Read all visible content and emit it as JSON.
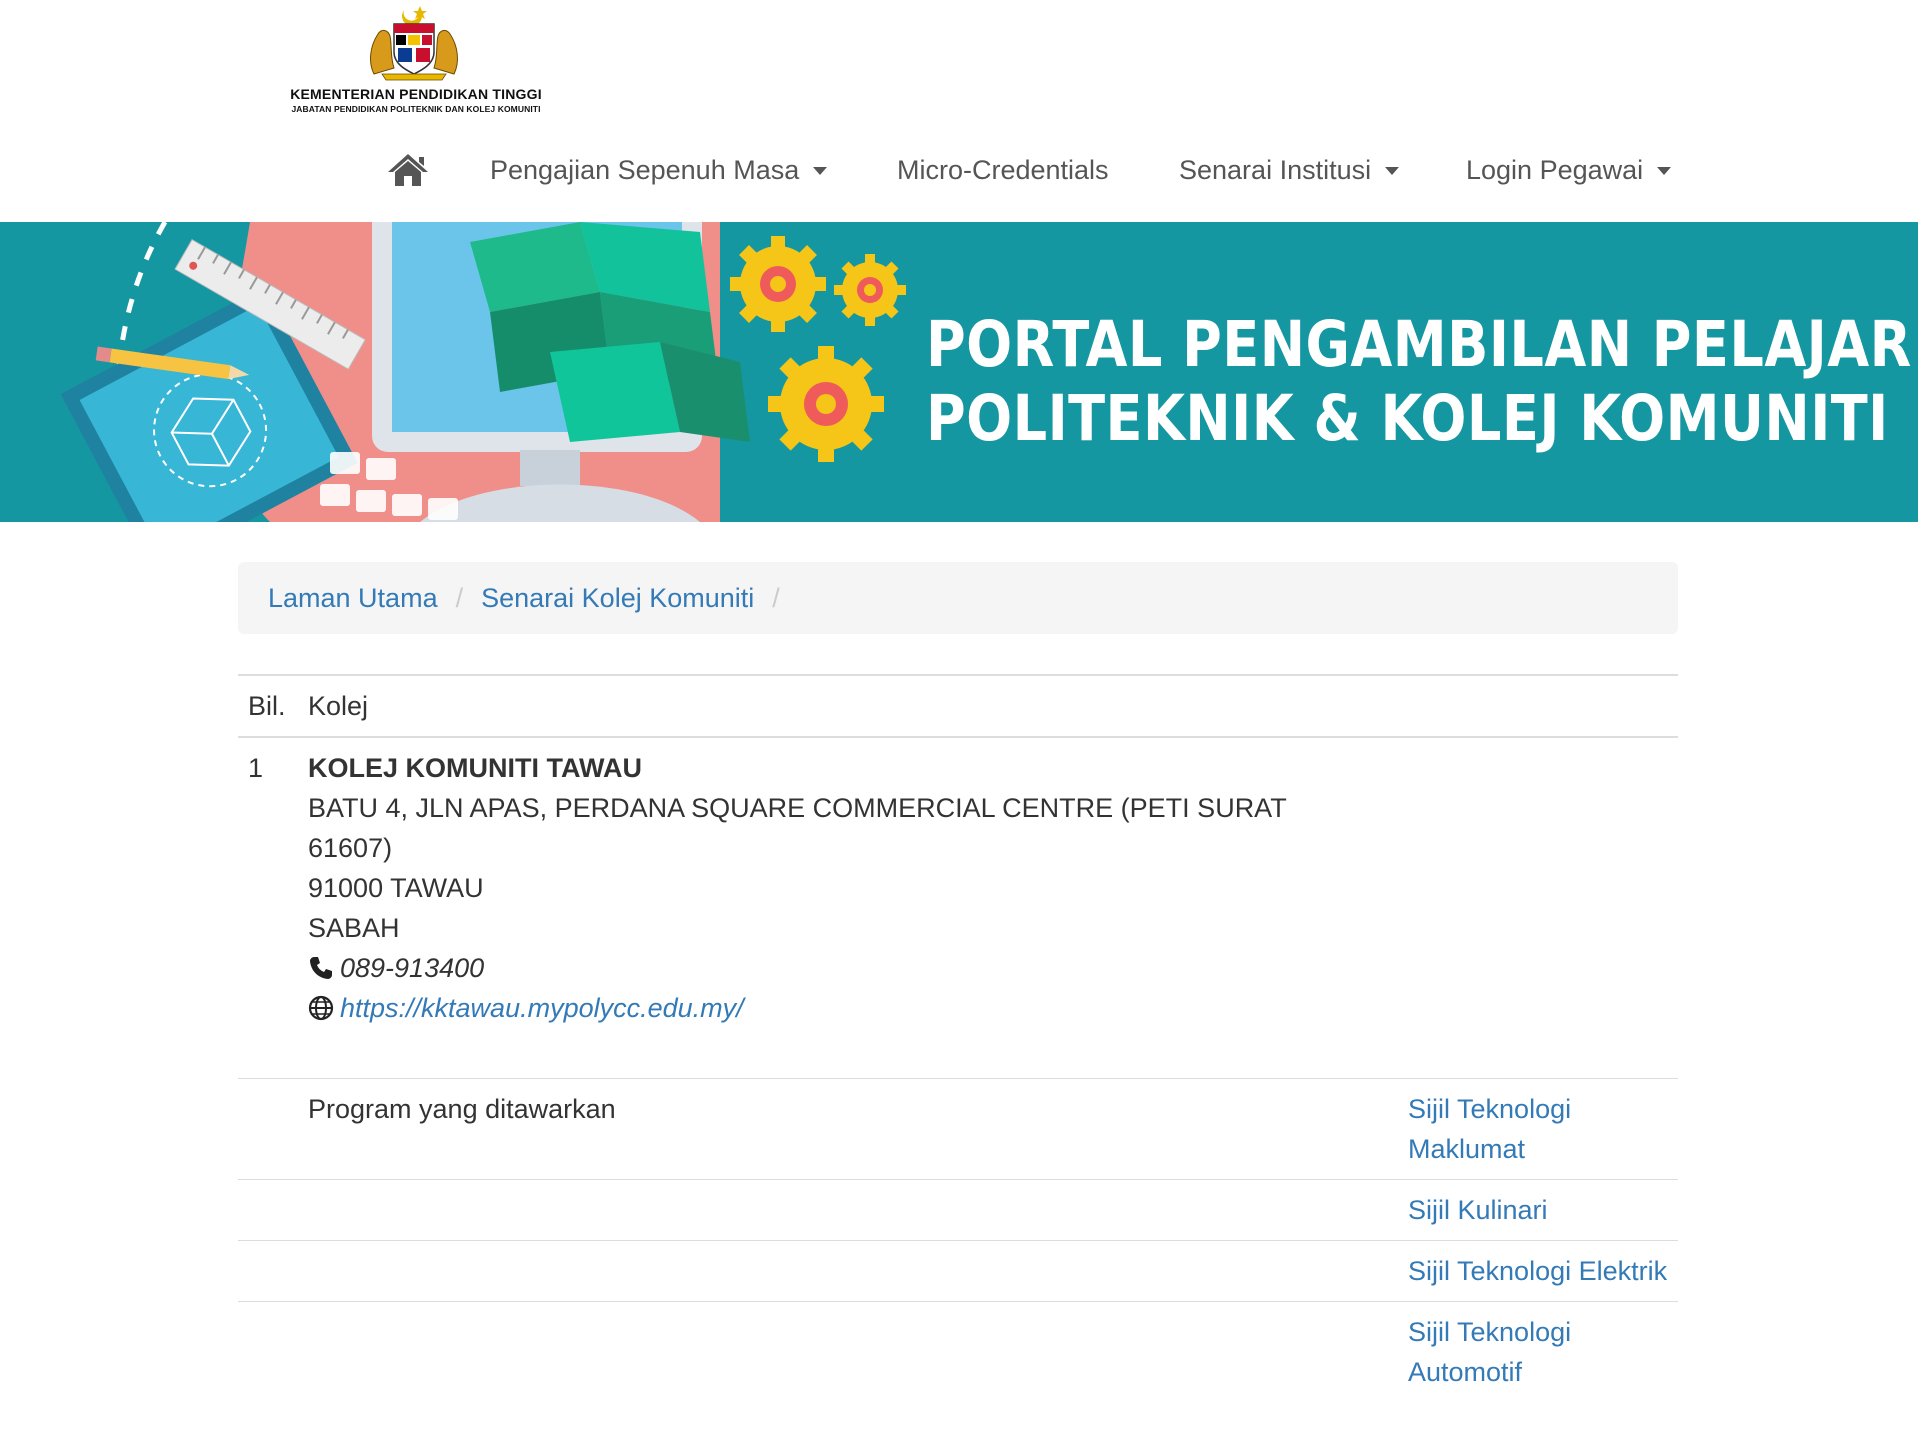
{
  "header": {
    "logo_line1": "KEMENTERIAN PENDIDIKAN TINGGI",
    "logo_line2": "JABATAN PENDIDIKAN POLITEKNIK DAN KOLEJ KOMUNITI",
    "nav": {
      "home_icon": "home-icon",
      "item1": "Pengajian Sepenuh Masa",
      "item2": "Micro-Credentials",
      "item3": "Senarai Institusi",
      "item4": "Login Pegawai"
    }
  },
  "banner": {
    "line1": "PORTAL PENGAMBILAN PELAJAR",
    "line2": "POLITEKNIK & KOLEJ KOMUNITI",
    "bg_color": "#1597a1"
  },
  "breadcrumb": {
    "item1": "Laman Utama",
    "item2": "Senarai Kolej Komuniti",
    "separator": "/"
  },
  "table": {
    "headers": {
      "bil": "Bil.",
      "kolej": "Kolej"
    },
    "row": {
      "bil": "1",
      "name": "KOLEJ KOMUNITI TAWAU",
      "address1": "BATU 4, JLN APAS, PERDANA SQUARE COMMERCIAL CENTRE (PETI SURAT",
      "address2": "61607)",
      "address3": "91000 TAWAU",
      "address4": "SABAH",
      "phone": "089-913400",
      "website": "https://kktawau.mypolycc.edu.my/"
    },
    "program_label": "Program yang ditawarkan",
    "programs": [
      {
        "line1": "Sijil Teknologi",
        "line2": "Maklumat"
      },
      {
        "line1": "Sijil Kulinari",
        "line2": ""
      },
      {
        "line1": "Sijil Teknologi Elektrik",
        "line2": ""
      },
      {
        "line1": "Sijil Teknologi",
        "line2": "Automotif"
      }
    ]
  },
  "colors": {
    "link": "#337ab7",
    "nav_text": "#555555",
    "banner": "#1597a1"
  }
}
